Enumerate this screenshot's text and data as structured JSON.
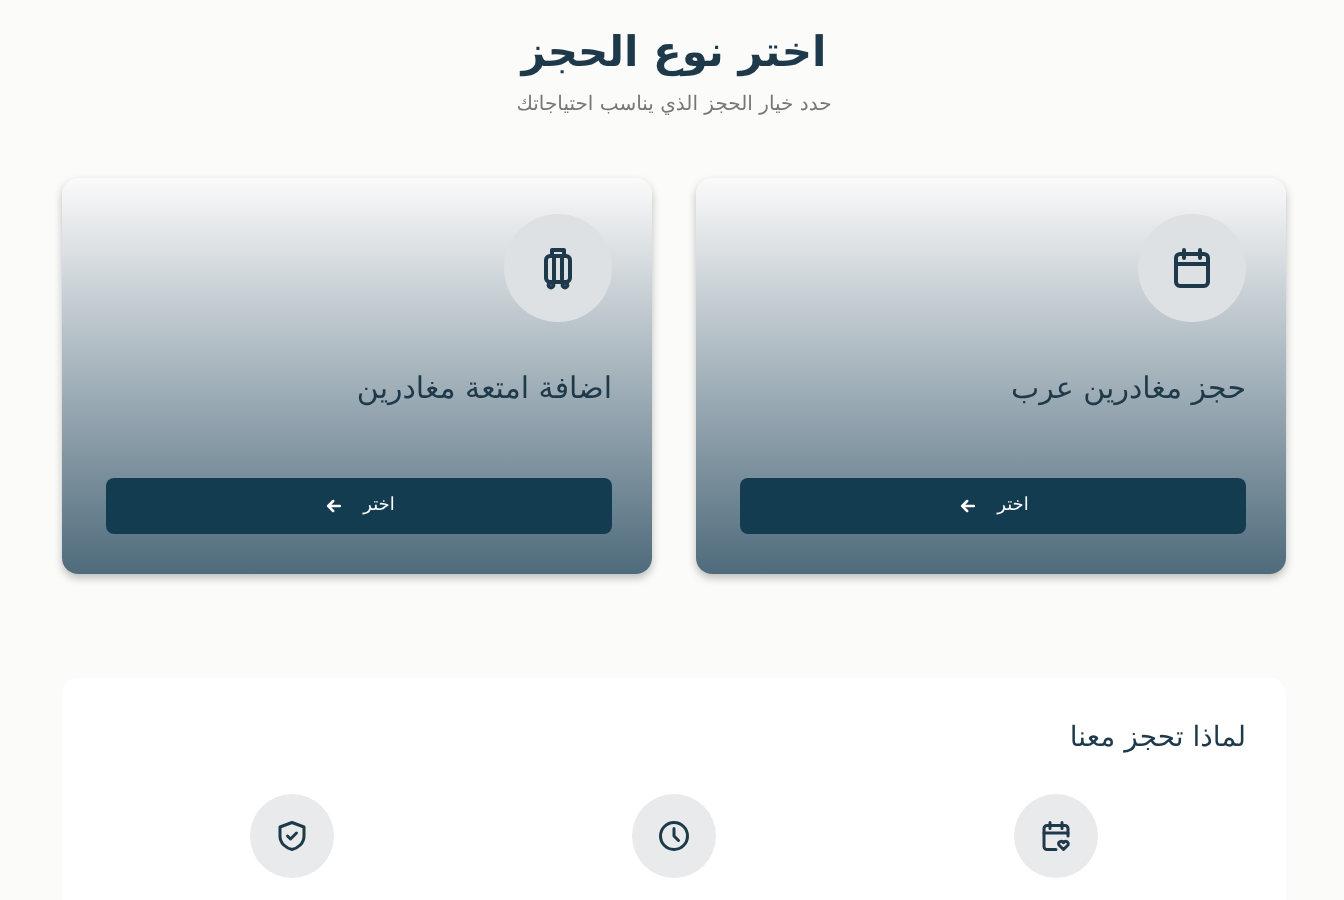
{
  "header": {
    "title": "اختر نوع الحجز",
    "subtitle": "حدد خيار الحجز الذي يناسب احتياجاتك"
  },
  "options": [
    {
      "title": "حجز مغادرين عرب",
      "button": "اختر"
    },
    {
      "title": "اضافة امتعة مغادرين",
      "button": "اختر"
    }
  ],
  "features": {
    "title": "لماذا تحجز معنا"
  }
}
